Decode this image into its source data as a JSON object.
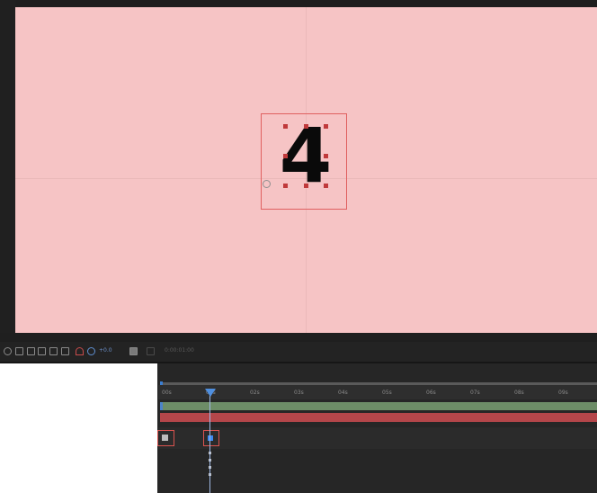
{
  "viewer": {
    "number_text": "4",
    "canvas_color": "#f6c4c5",
    "selection_color": "#e06060"
  },
  "toolbar": {
    "zoom_label": "+0.0",
    "timecode": "0:00:01:00",
    "icons": [
      "grid-icon",
      "mask-icon",
      "region-icon",
      "channel-icon",
      "display-icon",
      "color-icon",
      "exposure-icon",
      "camera-icon"
    ]
  },
  "timeline": {
    "ruler_labels": [
      "00s",
      "01s",
      "02s",
      "03s",
      "04s",
      "05s",
      "06s",
      "07s",
      "08s",
      "09s"
    ],
    "accent_color": "#3b7ed1",
    "keyframe_selected_color": "#3e8af0"
  }
}
